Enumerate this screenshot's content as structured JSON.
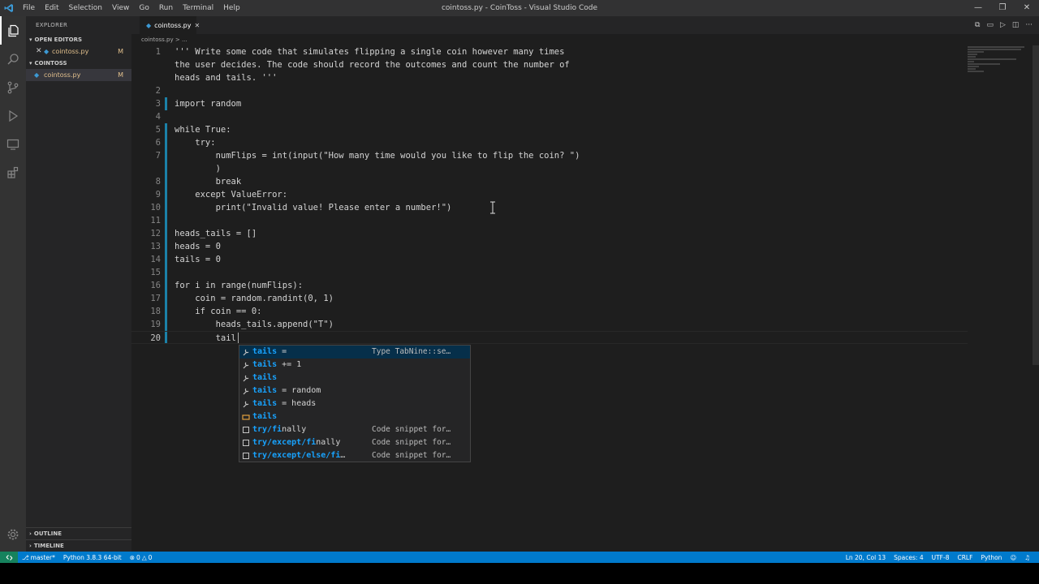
{
  "titlebar": {
    "menu": [
      "File",
      "Edit",
      "Selection",
      "View",
      "Go",
      "Run",
      "Terminal",
      "Help"
    ],
    "title": "cointoss.py - CoinToss - Visual Studio Code",
    "controls": [
      "—",
      "❐",
      "✕"
    ]
  },
  "sidebar": {
    "header": "EXPLORER",
    "open_editors_label": "OPEN EDITORS",
    "open_editors": [
      {
        "name": "cointoss.py",
        "badge": "M"
      }
    ],
    "folder_label": "COINTOSS",
    "files": [
      {
        "name": "cointoss.py",
        "badge": "M"
      }
    ],
    "outline_label": "OUTLINE",
    "timeline_label": "TIMELINE"
  },
  "editor": {
    "tab_name": "cointoss.py",
    "breadcrumb": "cointoss.py > ...",
    "lines": [
      {
        "n": "1",
        "text": "''' Write some code that simulates flipping a single coin however many times"
      },
      {
        "n": "",
        "text": "the user decides. The code should record the outcomes and count the number of"
      },
      {
        "n": "",
        "text": "heads and tails. '''"
      },
      {
        "n": "2",
        "text": ""
      },
      {
        "n": "3",
        "text": "import random"
      },
      {
        "n": "4",
        "text": ""
      },
      {
        "n": "5",
        "text": "while True:"
      },
      {
        "n": "6",
        "text": "    try:"
      },
      {
        "n": "7",
        "text": "        numFlips = int(input(\"How many time would you like to flip the coin? \")"
      },
      {
        "n": "",
        "text": "        )"
      },
      {
        "n": "8",
        "text": "        break"
      },
      {
        "n": "9",
        "text": "    except ValueError:"
      },
      {
        "n": "10",
        "text": "        print(\"Invalid value! Please enter a number!\")"
      },
      {
        "n": "11",
        "text": "        "
      },
      {
        "n": "12",
        "text": "heads_tails = []"
      },
      {
        "n": "13",
        "text": "heads = 0"
      },
      {
        "n": "14",
        "text": "tails = 0"
      },
      {
        "n": "15",
        "text": ""
      },
      {
        "n": "16",
        "text": "for i in range(numFlips):"
      },
      {
        "n": "17",
        "text": "    coin = random.randint(0, 1)"
      },
      {
        "n": "18",
        "text": "    if coin == 0:"
      },
      {
        "n": "19",
        "text": "        heads_tails.append(\"T\")"
      },
      {
        "n": "20",
        "text": "        tail"
      }
    ]
  },
  "suggestions": [
    {
      "match": "tails",
      "rest": " =",
      "detail": "Type TabNine::se…",
      "icon": "tabnine-icon"
    },
    {
      "match": "tails",
      "rest": " += 1",
      "detail": "",
      "icon": "tabnine-icon"
    },
    {
      "match": "tails",
      "rest": "",
      "detail": "",
      "icon": "tabnine-icon"
    },
    {
      "match": "tails",
      "rest": " = random",
      "detail": "",
      "icon": "tabnine-icon"
    },
    {
      "match": "tails",
      "rest": " = heads",
      "detail": "",
      "icon": "tabnine-icon"
    },
    {
      "match": "tails",
      "rest": "",
      "detail": "",
      "icon": "variable-icon"
    },
    {
      "match": "try/fi",
      "rest": "nally",
      "detail": "Code snippet for…",
      "icon": "snippet-icon"
    },
    {
      "match": "try/except/fi",
      "rest": "nally",
      "detail": "Code snippet for…",
      "icon": "snippet-icon"
    },
    {
      "match": "try/except/else/fi",
      "rest": "…",
      "detail": "Code snippet for…",
      "icon": "snippet-icon"
    }
  ],
  "statusbar": {
    "branch": "master*",
    "interpreter": "Python 3.8.3 64-bit",
    "errors": "0",
    "warnings": "0",
    "position": "Ln 20, Col 13",
    "spaces": "Spaces: 4",
    "encoding": "UTF-8",
    "eol": "CRLF",
    "language": "Python"
  },
  "colors": {
    "accent": "#007acc",
    "modified": "#e2c08d",
    "match": "#18a3ff"
  }
}
